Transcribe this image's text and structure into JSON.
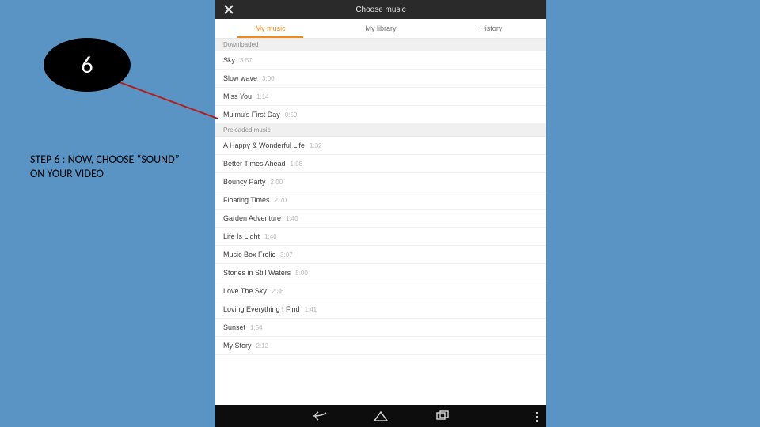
{
  "annotation": {
    "step_number": "6",
    "caption": "STEP 6 : NOW, CHOOSE “SOUND” ON YOUR VIDEO"
  },
  "phone": {
    "titlebar": {
      "title": "Choose music"
    },
    "tabs": [
      {
        "label": "My music",
        "active": true
      },
      {
        "label": "My library",
        "active": false
      },
      {
        "label": "History",
        "active": false
      }
    ],
    "sections": [
      {
        "header": "Downloaded",
        "songs": [
          {
            "title": "Sky",
            "duration": "3:57"
          },
          {
            "title": "Slow wave",
            "duration": "3:00"
          },
          {
            "title": "Miss You",
            "duration": "1:14"
          },
          {
            "title": "Muimu's First Day",
            "duration": "0:59"
          }
        ]
      },
      {
        "header": "Preloaded music",
        "songs": [
          {
            "title": "A Happy & Wonderful Life",
            "duration": "1:32"
          },
          {
            "title": "Better Times Ahead",
            "duration": "1:08"
          },
          {
            "title": "Bouncy Party",
            "duration": "2:00"
          },
          {
            "title": "Floating Times",
            "duration": "2:70"
          },
          {
            "title": "Garden Adventure",
            "duration": "1:40"
          },
          {
            "title": "Life Is Light",
            "duration": "1:40"
          },
          {
            "title": "Music Box Frolic",
            "duration": "3:07"
          },
          {
            "title": "Stones in Still Waters",
            "duration": "5:00"
          },
          {
            "title": "Love The Sky",
            "duration": "2:36"
          },
          {
            "title": "Loving Everything I Find",
            "duration": "1:41"
          },
          {
            "title": "Sunset",
            "duration": "1:54"
          },
          {
            "title": "My Story",
            "duration": "2:12"
          }
        ]
      }
    ]
  }
}
